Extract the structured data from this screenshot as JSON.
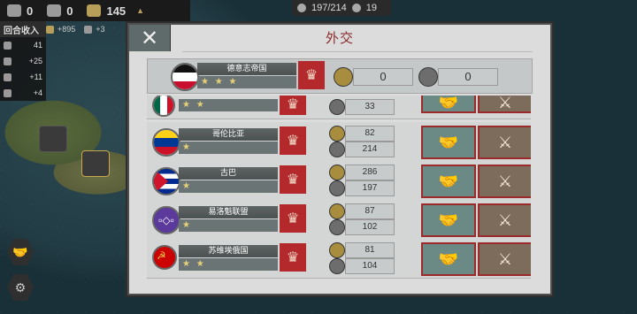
{
  "topbar": {
    "resource1": "0",
    "resource2": "0",
    "resource3": "145"
  },
  "topcenter": {
    "cities": "197/214",
    "generals": "19"
  },
  "leftstats": {
    "title": "回合收入",
    "income_gold": "+895",
    "income_second": "+3",
    "rows": [
      "41",
      "+25",
      "+11",
      "+4"
    ]
  },
  "dialog": {
    "title": "外交",
    "close_label": "✕",
    "self": {
      "name": "德意志帝国",
      "stars": "★ ★ ★",
      "gold": "0",
      "industry": "0"
    },
    "nations": [
      {
        "name": "",
        "stars": "★ ★",
        "gold": "",
        "industry": "33"
      },
      {
        "name": "哥伦比亚",
        "stars": "★",
        "gold": "82",
        "industry": "214"
      },
      {
        "name": "古巴",
        "stars": "★",
        "gold": "286",
        "industry": "197"
      },
      {
        "name": "易洛魁联盟",
        "stars": "★",
        "gold": "87",
        "industry": "102"
      },
      {
        "name": "苏维埃俄国",
        "stars": "★ ★",
        "gold": "81",
        "industry": "104"
      }
    ]
  },
  "icons": {
    "ally": "handshake-icon",
    "war": "crossed-swords-icon",
    "crown": "crown-icon"
  }
}
